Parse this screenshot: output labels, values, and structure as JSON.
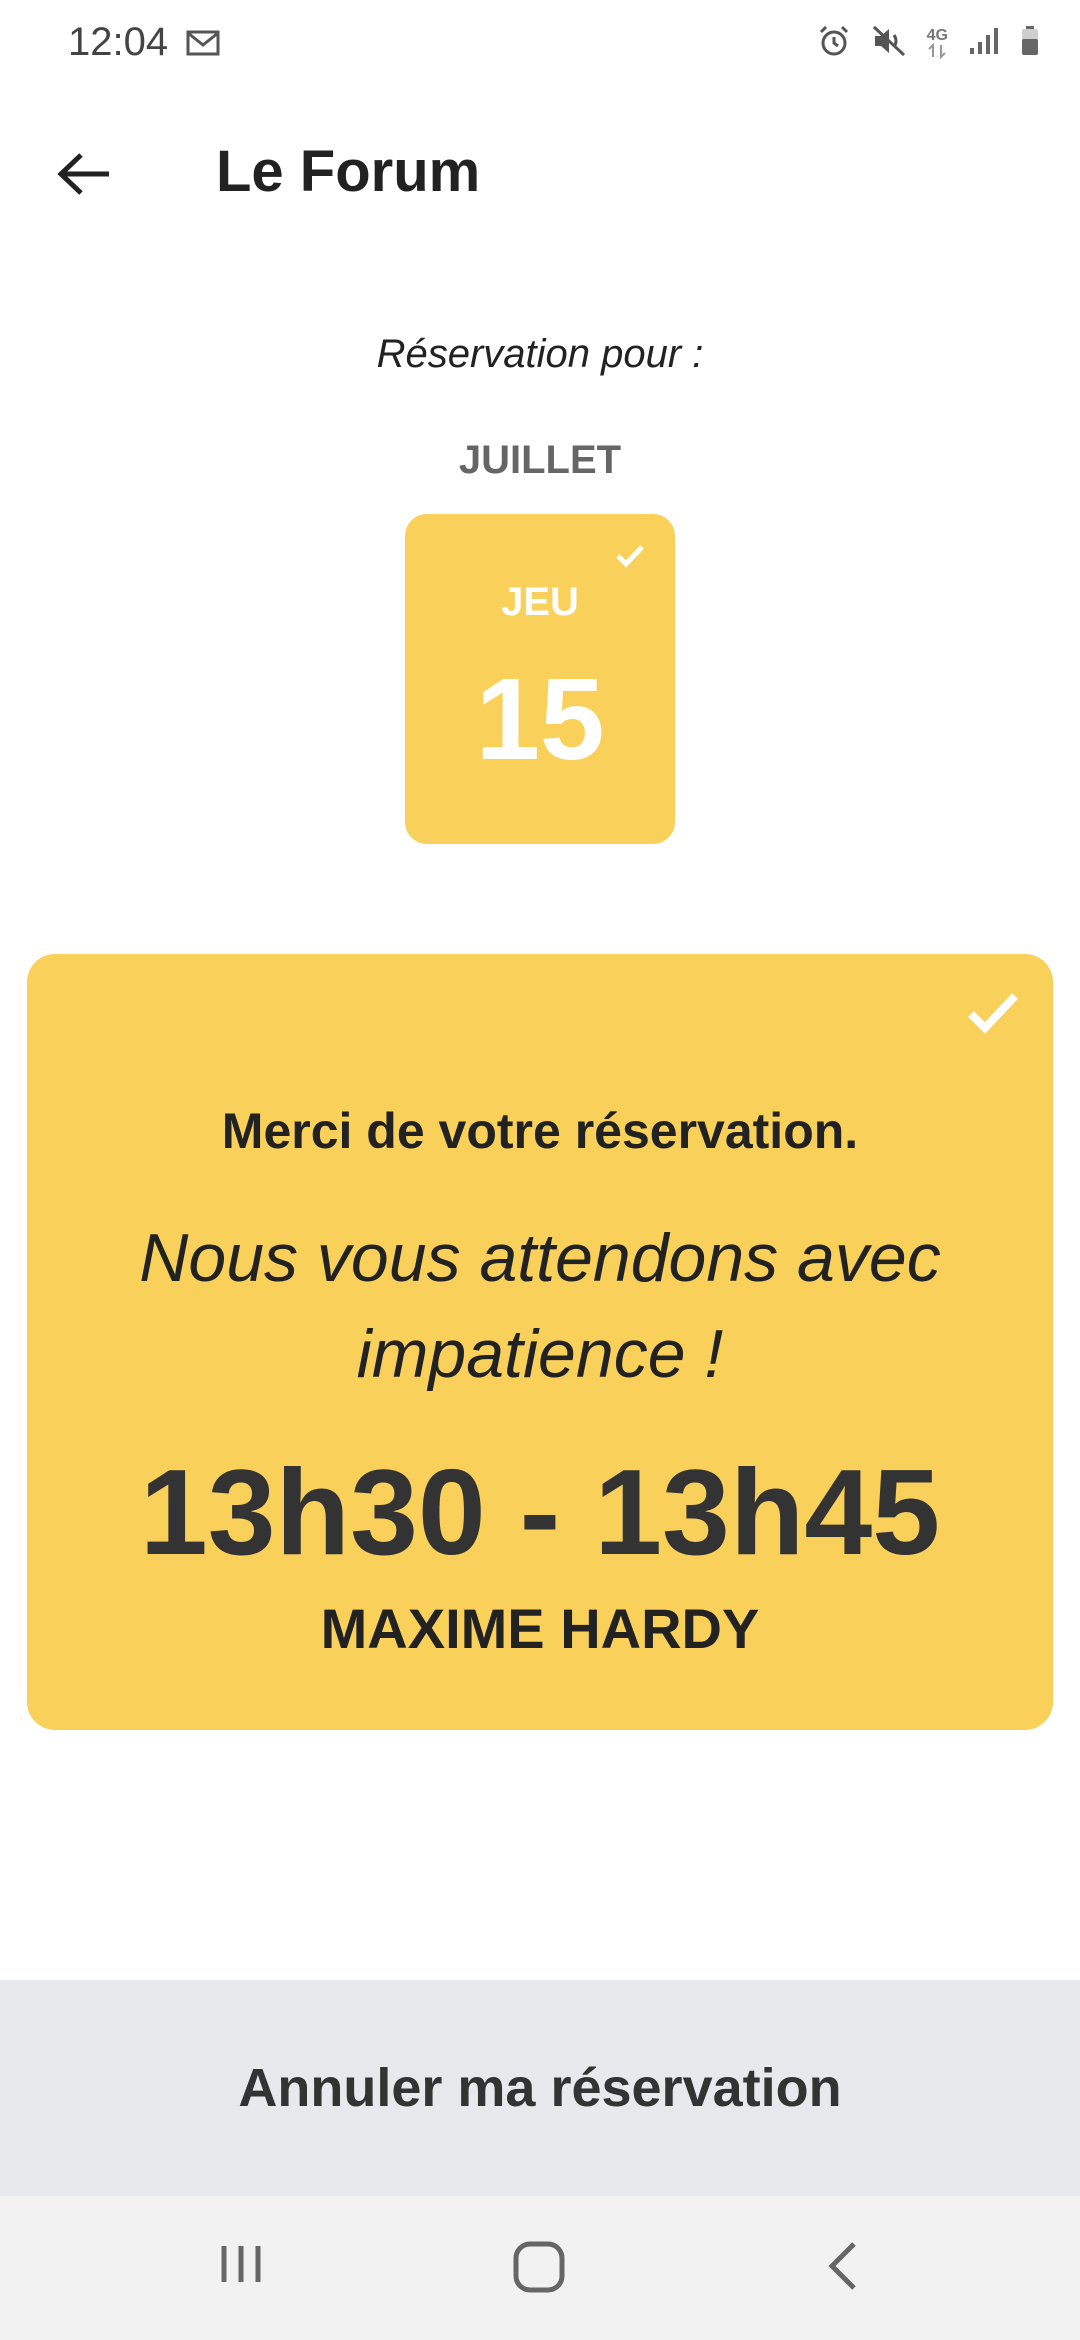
{
  "status_bar": {
    "time": "12:04",
    "icons": [
      "mail-icon",
      "alarm-icon",
      "mute-icon",
      "network-4g-icon",
      "signal-icon",
      "battery-icon"
    ],
    "network_label": "4G"
  },
  "app_bar": {
    "title": "Le Forum",
    "back_icon": "arrow-left-icon"
  },
  "reservation": {
    "label": "Réservation pour :",
    "month": "JUILLET",
    "day_abbrev": "JEU",
    "day_number": "15"
  },
  "confirmation": {
    "thanks": "Merci de votre réservation.",
    "message": "Nous vous attendons avec impatience !",
    "time_range": "13h30 - 13h45",
    "guest_name": "MAXIME HARDY"
  },
  "actions": {
    "cancel_label": "Annuler ma réservation"
  },
  "colors": {
    "accent": "#f9d15a",
    "cancel_bg": "#e8e9ec"
  }
}
